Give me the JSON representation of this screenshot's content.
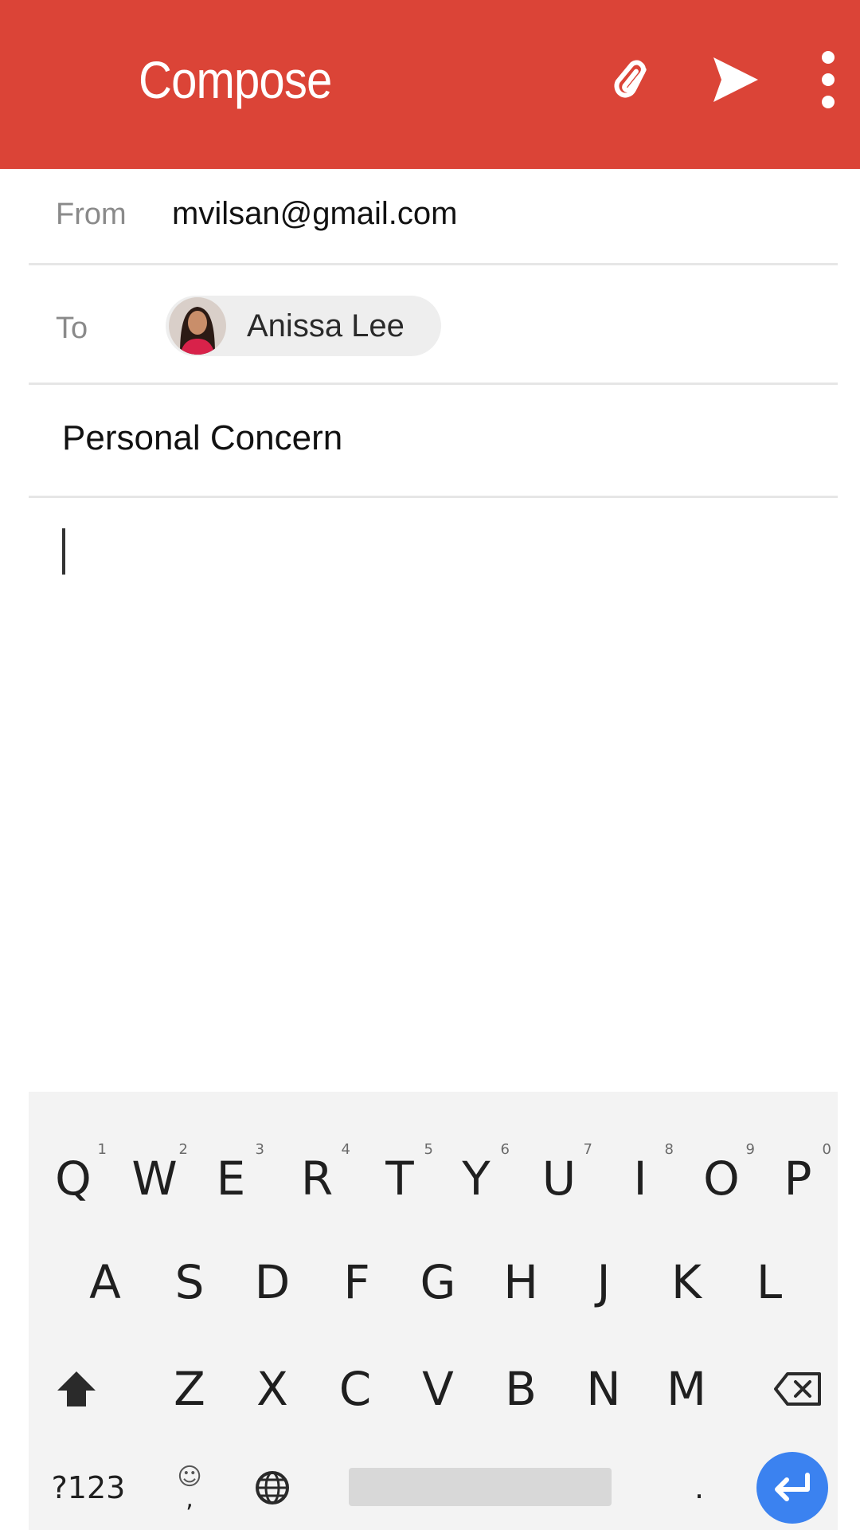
{
  "appbar": {
    "title": "Compose",
    "background": "#db4437",
    "actions": [
      {
        "icon": "paperclip-icon"
      },
      {
        "icon": "send-icon"
      },
      {
        "icon": "more-vert-icon"
      }
    ]
  },
  "from": {
    "label": "From",
    "value": "mvilsan@gmail.com"
  },
  "to": {
    "label": "To",
    "recipients": [
      {
        "name": "Anissa Lee",
        "avatar": "avatar-icon"
      }
    ]
  },
  "subject": {
    "value": "Personal Concern"
  },
  "body": {
    "value": ""
  },
  "keyboard": {
    "row1": [
      {
        "key": "Q",
        "hint": "1"
      },
      {
        "key": "W",
        "hint": "2"
      },
      {
        "key": "E",
        "hint": "3"
      },
      {
        "key": "R",
        "hint": "4"
      },
      {
        "key": "T",
        "hint": "5"
      },
      {
        "key": "Y",
        "hint": "6"
      },
      {
        "key": "U",
        "hint": "7"
      },
      {
        "key": "I",
        "hint": "8"
      },
      {
        "key": "O",
        "hint": "9"
      },
      {
        "key": "P",
        "hint": "0"
      }
    ],
    "row2": [
      "A",
      "S",
      "D",
      "F",
      "G",
      "H",
      "J",
      "K",
      "L"
    ],
    "row3": [
      "Z",
      "X",
      "C",
      "V",
      "B",
      "N",
      "M"
    ],
    "symbols_label": "?123",
    "emoji_label": "☺",
    "comma_label": ",",
    "period_label": ".",
    "enter_color": "#3b82f0"
  }
}
